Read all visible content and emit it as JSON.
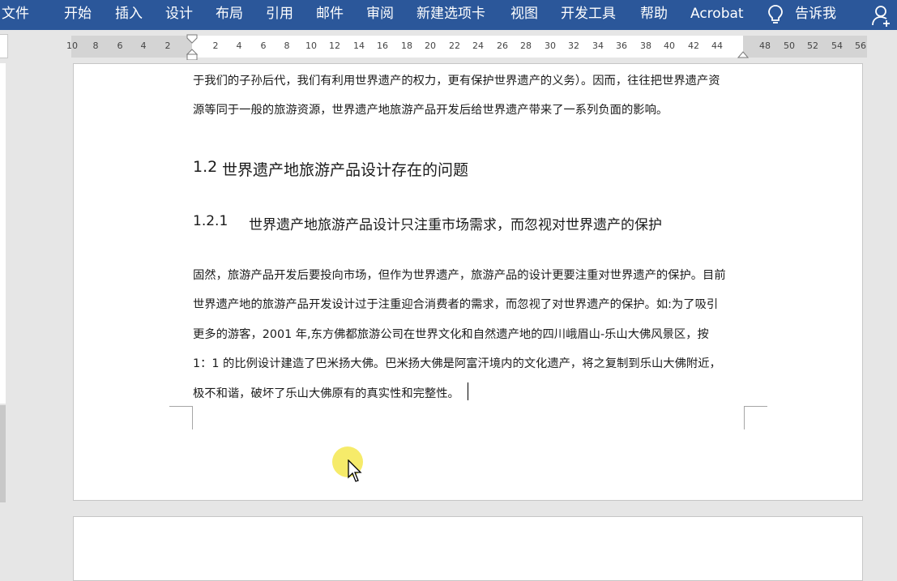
{
  "menubar": {
    "items": [
      "文件",
      "开始",
      "插入",
      "设计",
      "布局",
      "引用",
      "邮件",
      "审阅",
      "新建选项卡",
      "视图",
      "开发工具",
      "帮助",
      "Acrobat"
    ],
    "tell_me": "告诉我",
    "bulb_icon": "lightbulb-icon",
    "share_icon": "person-add-icon",
    "color": "#2b579a"
  },
  "ruler": {
    "left_numbers": [
      "10",
      "8",
      "6",
      "4",
      "2"
    ],
    "right_numbers": [
      "2",
      "4",
      "6",
      "8",
      "10",
      "12",
      "14",
      "16",
      "18",
      "20",
      "22",
      "24",
      "26",
      "28",
      "30",
      "32",
      "34",
      "36",
      "38",
      "40",
      "42",
      "44"
    ],
    "margin_numbers": [
      "48",
      "50",
      "52",
      "54",
      "56"
    ]
  },
  "document": {
    "para1": [
      "于我们的子孙后代，我们有利用世界遗产的权力，更有保护世界遗产的义务）。因而，往往把世界遗产资",
      "源等同于一般的旅游资源，世界遗产地旅游产品开发后给世界遗产带来了一系列负面的影响。"
    ],
    "heading2_number": "1.2",
    "heading2_text": "世界遗产地旅游产品设计存在的问题",
    "heading3_number": "1.2.1",
    "heading3_text": "世界遗产地旅游产品设计只注重市场需求，而忽视对世界遗产的保护",
    "para2": [
      "固然，旅游产品开发后要投向市场，但作为世界遗产，旅游产品的设计更要注重对世界遗产的保护。目前",
      "世界遗产地的旅游产品开发设计过于注重迎合消费者的需求，而忽视了对世界遗产的保护。如:为了吸引",
      "更多的游客，2001 年,东方佛都旅游公司在世界文化和自然遗产地的四川峨眉山-乐山大佛风景区，按",
      "1：1  的比例设计建造了巴米扬大佛。巴米扬大佛是阿富汗境内的文化遗产，将之复制到乐山大佛附近，",
      "极不和谐，破坏了乐山大佛原有的真实性和完整性。"
    ]
  }
}
